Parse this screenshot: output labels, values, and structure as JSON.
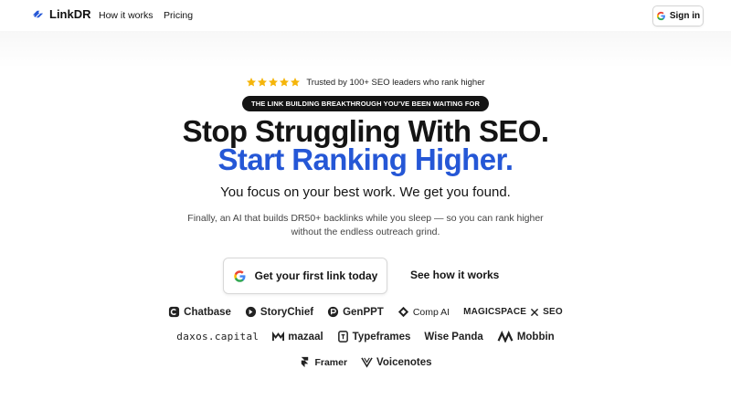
{
  "nav": {
    "brand": "LinkDR",
    "links": [
      "How it works",
      "Pricing"
    ],
    "signin_label": "Sign in"
  },
  "hero": {
    "trust_text": "Trusted by 100+ SEO leaders who rank higher",
    "pill": "THE LINK BUILDING BREAKTHROUGH YOU'VE BEEN WAITING FOR",
    "headline_1": "Stop Struggling With SEO.",
    "headline_2": "Start Ranking Higher.",
    "subhead": "You focus on your best work. We get you found.",
    "description": "Finally, an AI that builds DR50+ backlinks while you sleep — so you can rank higher without the endless outreach grind.",
    "cta_primary": "Get your first link today",
    "cta_secondary": "See how it works"
  },
  "logos": {
    "row1": [
      "Chatbase",
      "StoryChief",
      "GenPPT",
      "Comp AI",
      "MAGICSPACE",
      "SEO"
    ],
    "row2": [
      "daxos.capital",
      "mazaal",
      "Typeframes",
      "Wise Panda",
      "Mobbin"
    ],
    "row3": [
      "Framer",
      "Voicenotes"
    ]
  },
  "colors": {
    "accent": "#2557d6",
    "star": "#f5b50a",
    "pill_bg": "#141414"
  }
}
